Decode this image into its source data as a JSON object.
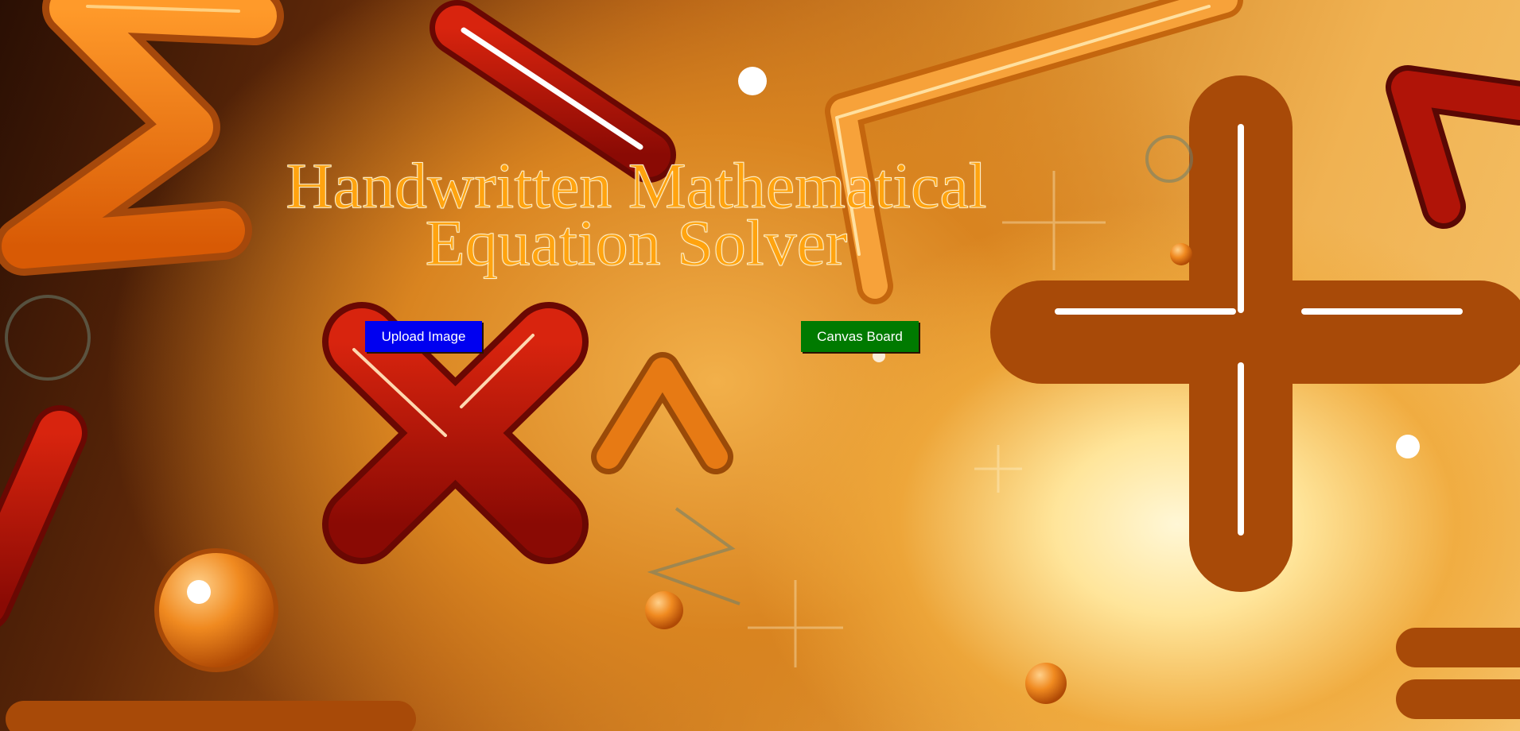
{
  "page": {
    "title_line1": "Handwritten Mathematical",
    "title_line2": "Equation Solver"
  },
  "actions": {
    "upload_label": "Upload Image",
    "canvas_label": "Canvas Board"
  },
  "colors": {
    "title": "#ffa30f",
    "upload_button": "#0000f0",
    "canvas_button": "#007a00"
  }
}
